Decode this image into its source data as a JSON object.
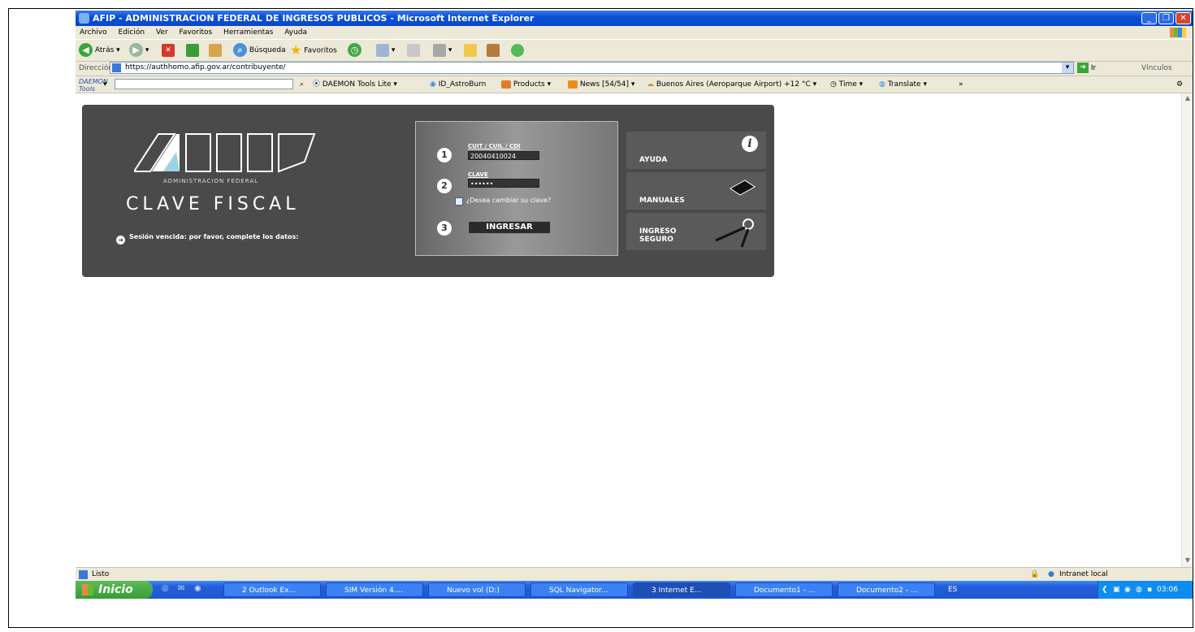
{
  "window": {
    "title": "AFIP - ADMINISTRACION FEDERAL DE INGRESOS PUBLICOS - Microsoft Internet Explorer"
  },
  "menu": [
    "Archivo",
    "Edición",
    "Ver",
    "Favoritos",
    "Herramientas",
    "Ayuda"
  ],
  "toolbar": {
    "back": "Atrás",
    "search": "Búsqueda",
    "favorites": "Favoritos"
  },
  "address": {
    "label": "Dirección",
    "url": "https://authhomo.afip.gov.ar/contribuyente/",
    "go": "Ir",
    "links": "Vínculos"
  },
  "links_bar": {
    "daemon_logo": "DAEMON Tools",
    "daemon_lite": "DAEMON Tools Lite",
    "astroburn": "ID_AstroBurn",
    "products": "Products",
    "news": "News [54/54]",
    "weather": "Buenos Aires (Aeroparque Airport) +12 °C",
    "time": "Time",
    "translate": "Translate",
    "more": "»"
  },
  "afip": {
    "logo_subtitle": "ADMINISTRACION FEDERAL",
    "heading": "CLAVE FISCAL",
    "session_msg": "Sesión vencida: por favor, complete los datos:",
    "step1": "1",
    "step2": "2",
    "step3": "3",
    "cuit_label": "CUIT / CUIL / CDI",
    "cuit_value": "20040410024",
    "clave_label": "CLAVE",
    "clave_value": "••••••",
    "change_pass": "¿Desea cambiar su clave?",
    "submit": "INGRESAR",
    "ayuda": "AYUDA",
    "manuales": "MANUALES",
    "ingreso_seguro_1": "INGRESO",
    "ingreso_seguro_2": "SEGURO"
  },
  "status": {
    "text": "Listo",
    "zone": "Intranet local"
  },
  "taskbar": {
    "start": "Inicio",
    "items": [
      "2 Outlook Ex...",
      "SIM Versión 4....",
      "Nuevo vol (D:)",
      "SQL Navigator...",
      "3 Internet E...",
      "Documento1 - ...",
      "Documento2 - ..."
    ],
    "lang": "ES",
    "clock": "03:06 p.m."
  }
}
